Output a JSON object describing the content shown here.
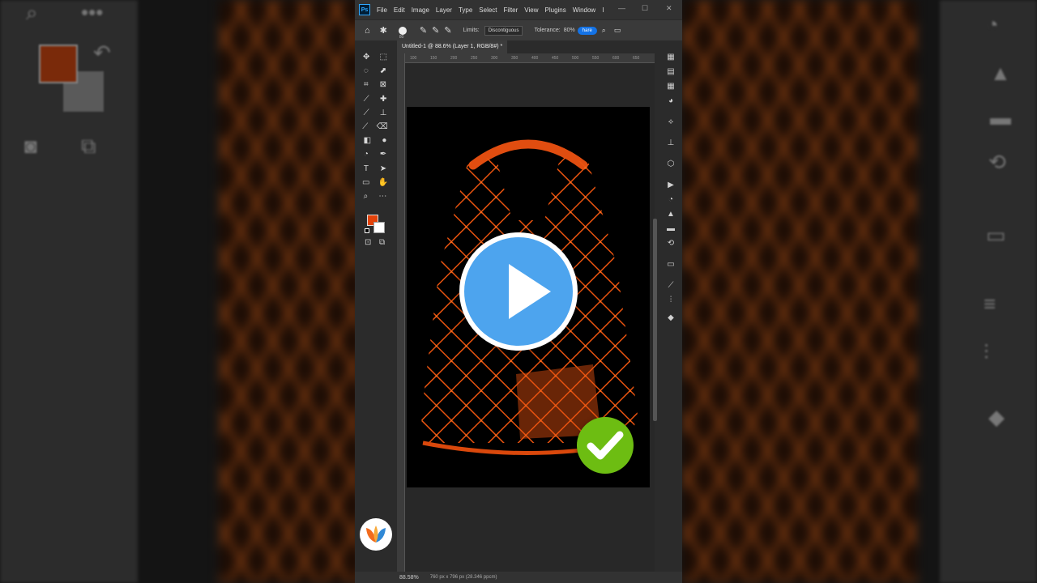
{
  "app": {
    "logo_text": "Ps",
    "menu": [
      "File",
      "Edit",
      "Image",
      "Layer",
      "Type",
      "Select",
      "Filter",
      "View",
      "Plugins",
      "Window",
      "I"
    ]
  },
  "options_bar": {
    "brush_size": "80",
    "limits_label": "Limits:",
    "limits_value": "Discontiguous",
    "tolerance_label": "Tolerance:",
    "tolerance_value": "80%",
    "share_label": "hare"
  },
  "document": {
    "tab_title": "Untitled-1 @ 88.6% (Layer 1, RGB/8#) *",
    "ruler_ticks": [
      "100",
      "150",
      "200",
      "250",
      "300",
      "350",
      "400",
      "450",
      "500",
      "550",
      "600",
      "650"
    ]
  },
  "status": {
    "zoom": "88.58%",
    "doc_size": "760 px x 796 px (28.346 ppcm)"
  },
  "colors": {
    "foreground": "#e2420a",
    "background": "#ffffff",
    "bag": "#e8530f",
    "play_button": "#4da4ee",
    "check_badge": "#6dbd12"
  },
  "overlays": {
    "play_icon": "play-icon",
    "check_icon": "check-icon",
    "channel_logo": "leaf-logo-icon"
  }
}
